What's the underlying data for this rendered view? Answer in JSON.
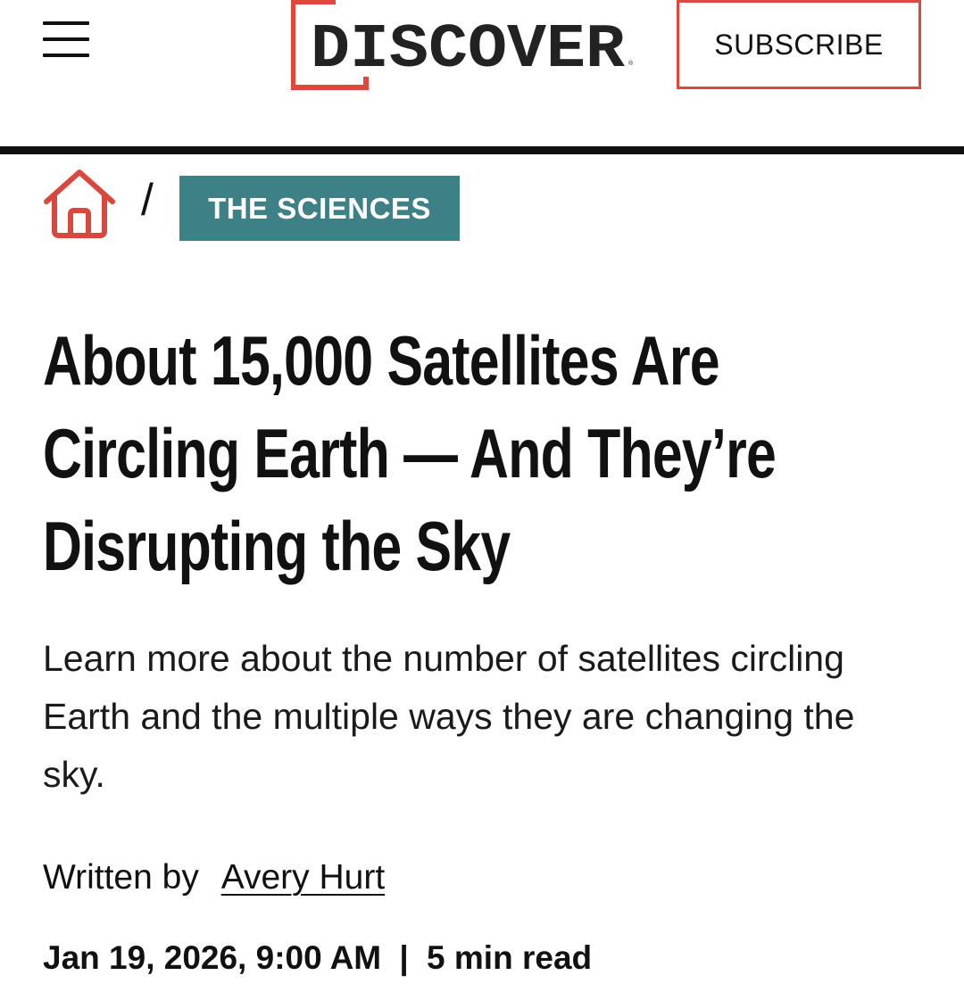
{
  "header": {
    "logo_text": "DISCOVER",
    "subscribe_label": "SUBSCRIBE",
    "accent_color": "#e0473c"
  },
  "breadcrumb": {
    "home_icon": "home-icon",
    "separator": "/",
    "category": "THE SCIENCES",
    "category_color": "#3d8085"
  },
  "article": {
    "headline": "About 15,000 Satellites Are Circling Earth — And They’re Disrupting the Sky",
    "dek": "Learn more about the number of satellites circling Earth and the multiple ways they are changing the sky.",
    "byline_prefix": "Written by",
    "author": "Avery Hurt",
    "date": "Jan 19, 2026, 9:00 AM",
    "meta_separator": "|",
    "read_time": "5 min read"
  }
}
